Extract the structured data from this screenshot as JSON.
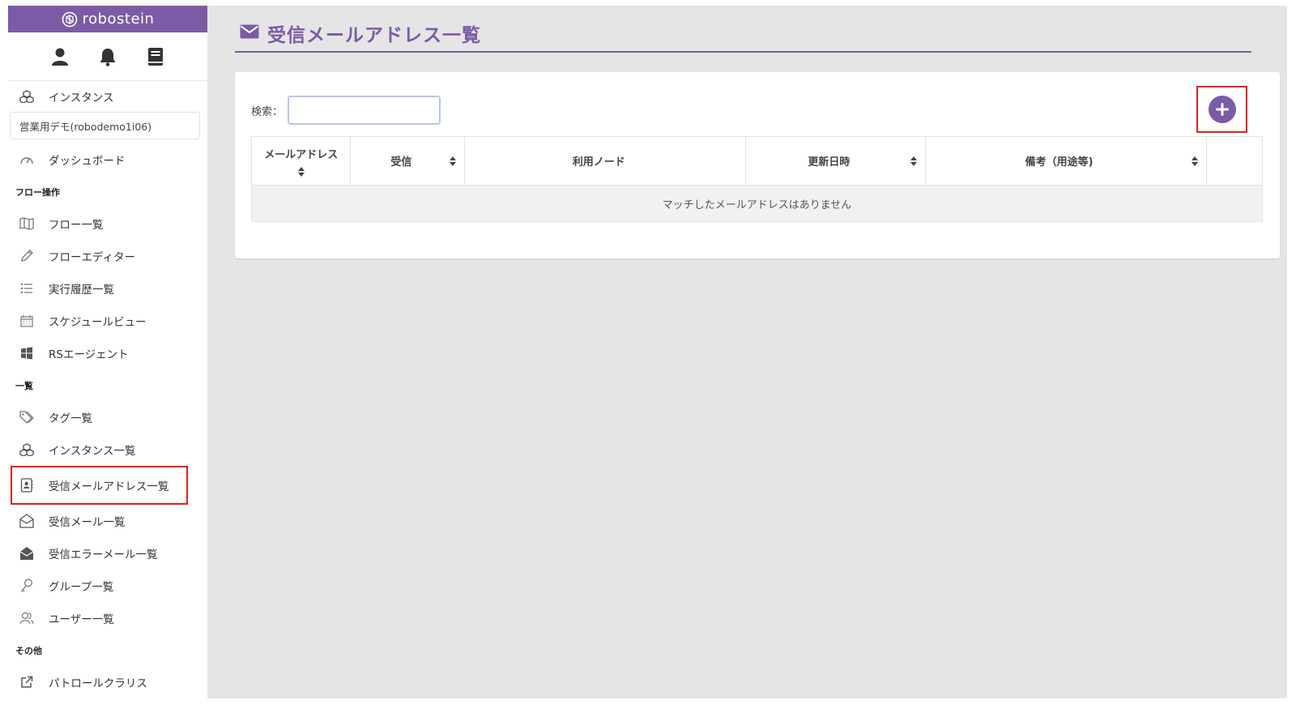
{
  "brand": {
    "name": "robostein"
  },
  "top_icons": [
    "user-icon",
    "bell-icon",
    "book-icon"
  ],
  "sidebar": {
    "instance_label": "インスタンス",
    "instance_value": "営業用デモ(robodemo1i06)",
    "dashboard": "ダッシュボード",
    "sections": [
      {
        "label": "フロー操作",
        "items": [
          {
            "label": "フロー一覧",
            "icon": "map-icon"
          },
          {
            "label": "フローエディター",
            "icon": "pencil-icon"
          },
          {
            "label": "実行履歴一覧",
            "icon": "list-icon"
          },
          {
            "label": "スケジュールビュー",
            "icon": "calendar-icon"
          },
          {
            "label": "RSエージェント",
            "icon": "windows-icon"
          }
        ]
      },
      {
        "label": "一覧",
        "items": [
          {
            "label": "タグ一覧",
            "icon": "tags-icon"
          },
          {
            "label": "インスタンス一覧",
            "icon": "cubes-icon"
          },
          {
            "label": "受信メールアドレス一覧",
            "icon": "address-book-icon",
            "active": true
          },
          {
            "label": "受信メール一覧",
            "icon": "envelope-open-icon"
          },
          {
            "label": "受信エラーメール一覧",
            "icon": "envelope-filled-icon"
          },
          {
            "label": "グループ一覧",
            "icon": "key-icon"
          },
          {
            "label": "ユーザー一覧",
            "icon": "users-icon"
          }
        ]
      },
      {
        "label": "その他",
        "items": [
          {
            "label": "パトロールクラリス",
            "icon": "external-link-icon"
          }
        ]
      }
    ]
  },
  "page": {
    "title": "受信メールアドレス一覧",
    "title_icon": "envelope-icon",
    "search_label": "検索：",
    "search_value": "",
    "add_icon": "plus-icon"
  },
  "table": {
    "columns": [
      "メールアドレス",
      "受信",
      "利用ノード",
      "更新日時",
      "備考（用途等)",
      ""
    ],
    "empty_message": "マッチしたメールアドレスはありません"
  },
  "colors": {
    "accent": "#7b5ba6",
    "highlight": "#e02020",
    "background": "#e5e5e6"
  }
}
